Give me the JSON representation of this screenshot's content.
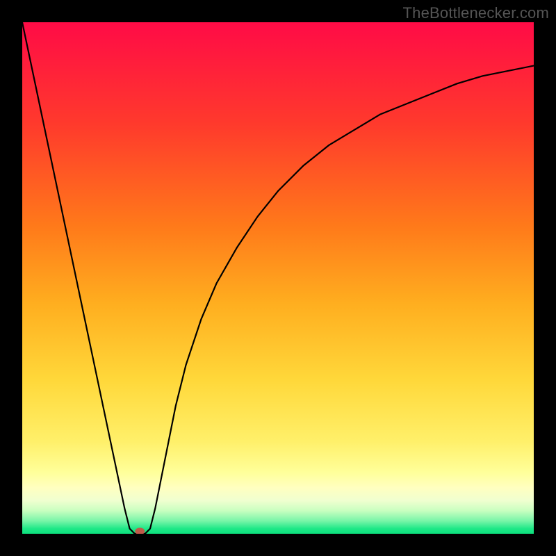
{
  "attribution": "TheBottlenecker.com",
  "chart_data": {
    "type": "line",
    "title": "",
    "xlabel": "",
    "ylabel": "",
    "xlim": [
      0,
      100
    ],
    "ylim": [
      0,
      100
    ],
    "x": [
      0,
      2,
      4,
      6,
      8,
      10,
      12,
      14,
      16,
      18,
      20,
      21,
      22,
      23,
      24,
      25,
      26,
      28,
      30,
      32,
      35,
      38,
      42,
      46,
      50,
      55,
      60,
      65,
      70,
      75,
      80,
      85,
      90,
      95,
      100
    ],
    "values": [
      100,
      90.5,
      81,
      71.5,
      62,
      52.5,
      43,
      33.5,
      24,
      14.5,
      5,
      1,
      0,
      0,
      0,
      1,
      5,
      15,
      25,
      33,
      42,
      49,
      56,
      62,
      67,
      72,
      76,
      79,
      82,
      84,
      86,
      88,
      89.5,
      90.5,
      91.5
    ],
    "marker": {
      "x": 23,
      "y": 0.5,
      "color": "#c05a4a"
    },
    "gradient_stops": [
      {
        "offset": 0.0,
        "color": "#ff0b46"
      },
      {
        "offset": 0.2,
        "color": "#ff3a2c"
      },
      {
        "offset": 0.4,
        "color": "#ff7a1a"
      },
      {
        "offset": 0.55,
        "color": "#ffae1f"
      },
      {
        "offset": 0.7,
        "color": "#ffd83a"
      },
      {
        "offset": 0.82,
        "color": "#fff06a"
      },
      {
        "offset": 0.88,
        "color": "#ffff9a"
      },
      {
        "offset": 0.91,
        "color": "#ffffc0"
      },
      {
        "offset": 0.935,
        "color": "#f0ffd0"
      },
      {
        "offset": 0.955,
        "color": "#c8ffc0"
      },
      {
        "offset": 0.975,
        "color": "#78f5a8"
      },
      {
        "offset": 0.99,
        "color": "#1ee887"
      },
      {
        "offset": 1.0,
        "color": "#0ce07d"
      }
    ]
  }
}
